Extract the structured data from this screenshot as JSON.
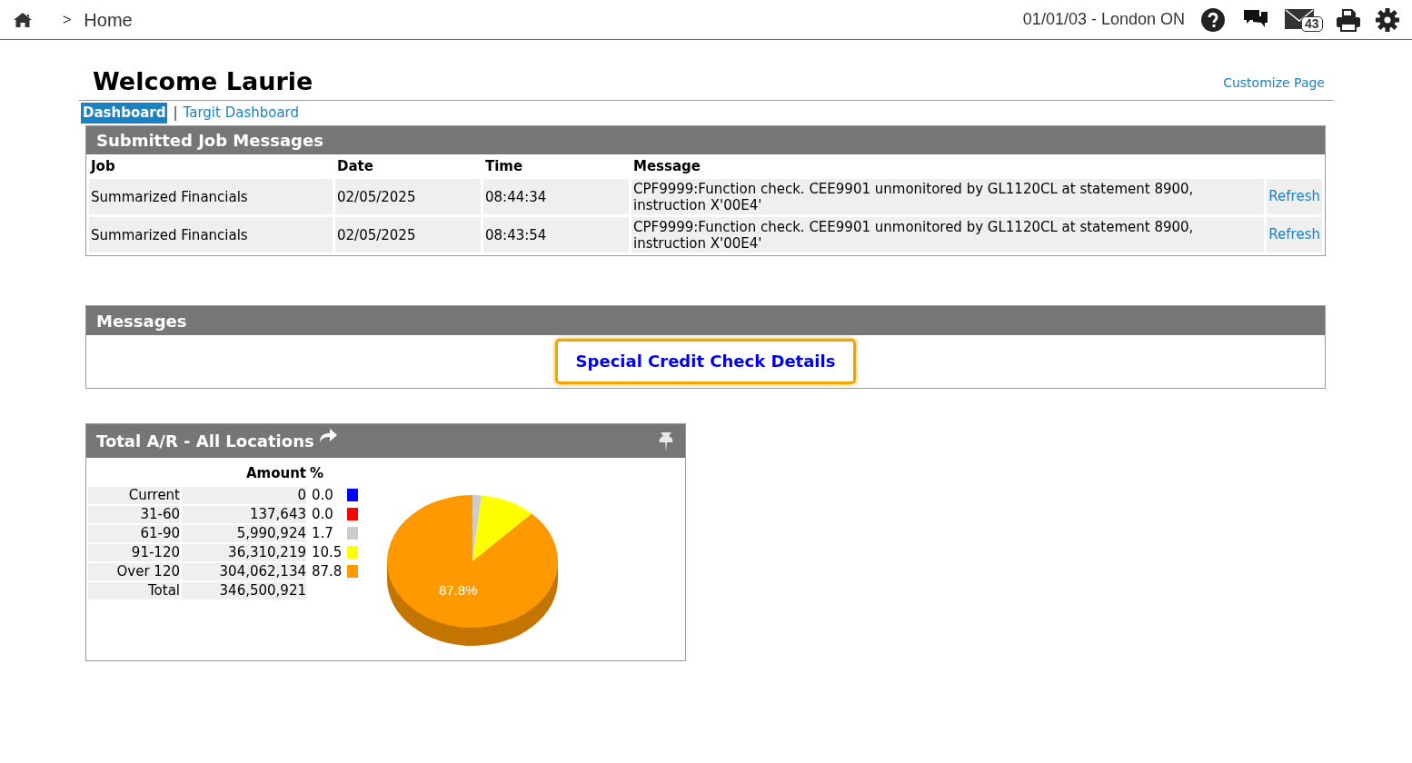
{
  "top_bar": {
    "breadcrumb_separator": ">",
    "breadcrumb": "Home",
    "location": "01/01/03 - London ON",
    "mail_count": "43"
  },
  "welcome": "Welcome Laurie",
  "customize_link": "Customize Page",
  "tabs": [
    {
      "label": "Dashboard",
      "selected": true
    },
    {
      "label": "Targit Dashboard",
      "selected": false
    }
  ],
  "tab_separator": "|",
  "job_messages": {
    "title": "Submitted Job Messages",
    "columns": [
      "Job",
      "Date",
      "Time",
      "Message"
    ],
    "rows": [
      {
        "job": "Summarized Financials",
        "date": "02/05/2025",
        "time": "08:44:34",
        "message": "CPF9999:Function check. CEE9901 unmonitored by GL1120CL at statement 8900, instruction X'00E4'",
        "action": "Refresh"
      },
      {
        "job": "Summarized Financials",
        "date": "02/05/2025",
        "time": "08:43:54",
        "message": "CPF9999:Function check. CEE9901 unmonitored by GL1120CL at statement 8900, instruction X'00E4'",
        "action": "Refresh"
      }
    ]
  },
  "messages": {
    "title": "Messages",
    "link": "Special Credit Check Details"
  },
  "ar": {
    "title": "Total A/R - All Locations",
    "columns": [
      "Amount",
      "%"
    ],
    "rows": [
      {
        "label": "Current",
        "amount": "0",
        "percent": "0.0",
        "color": "#0000ff"
      },
      {
        "label": "31-60",
        "amount": "137,643",
        "percent": "0.0",
        "color": "#ff0000"
      },
      {
        "label": "61-90",
        "amount": "5,990,924",
        "percent": "1.7",
        "color": "#cccccc"
      },
      {
        "label": "91-120",
        "amount": "36,310,219",
        "percent": "10.5",
        "color": "#ffff00"
      },
      {
        "label": "Over 120",
        "amount": "304,062,134",
        "percent": "87.8",
        "color": "#ff9900"
      }
    ],
    "total": {
      "label": "Total",
      "amount": "346,500,921"
    },
    "pie_label": "87.8%"
  }
}
